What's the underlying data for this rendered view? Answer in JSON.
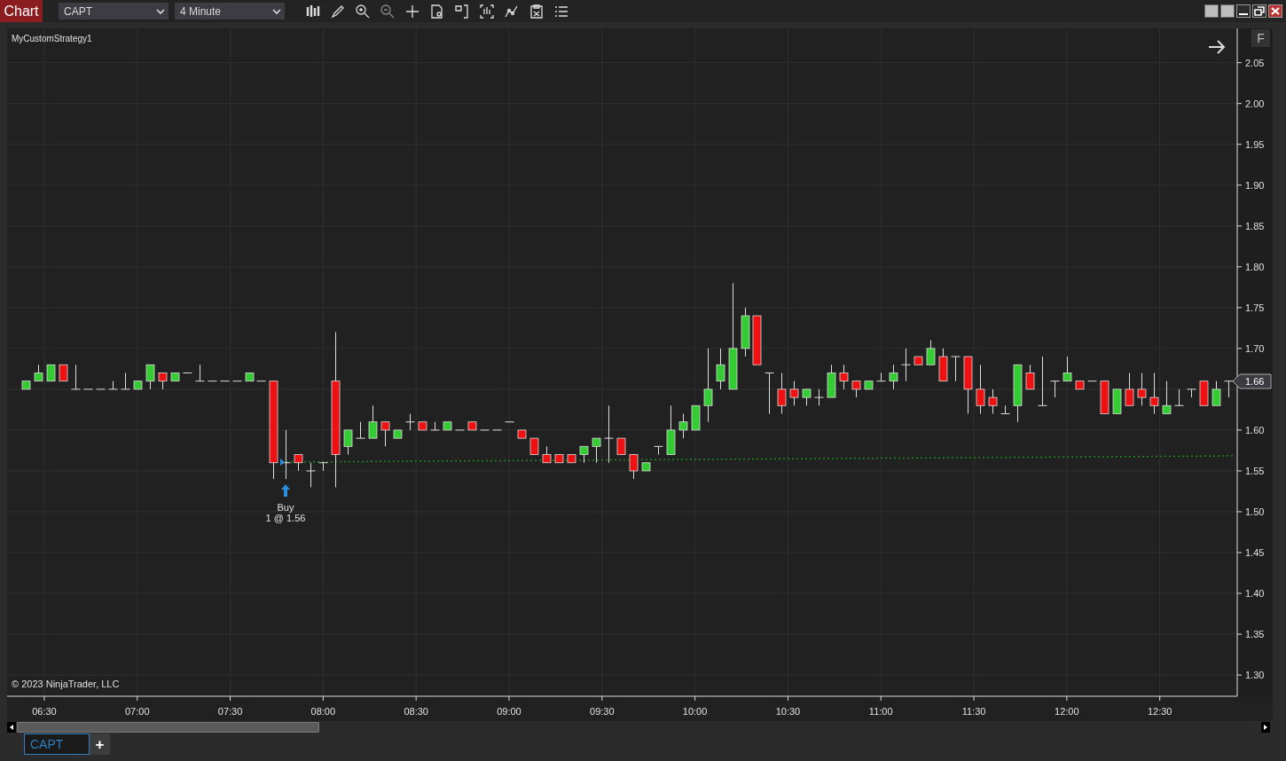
{
  "window": {
    "title": "Chart"
  },
  "toolbar": {
    "instrument": "CAPT",
    "interval": "4 Minute"
  },
  "chart": {
    "strategy_label": "MyCustomStrategy1",
    "scale_button": "F",
    "copyright": "© 2023 NinjaTrader, LLC",
    "current_price": "1.66",
    "execution": {
      "action": "Buy",
      "detail": "1 @ 1.56"
    },
    "chart_data": {
      "type": "candlestick",
      "grid": true,
      "ylim": [
        1.274,
        2.092
      ],
      "xlim": [
        378,
        775
      ],
      "yticks": [
        {
          "value": 2.05,
          "label": "2.05"
        },
        {
          "value": 2.0,
          "label": "2.00"
        },
        {
          "value": 1.95,
          "label": "1.95"
        },
        {
          "value": 1.9,
          "label": "1.90"
        },
        {
          "value": 1.85,
          "label": "1.85"
        },
        {
          "value": 1.8,
          "label": "1.80"
        },
        {
          "value": 1.75,
          "label": "1.75"
        },
        {
          "value": 1.7,
          "label": "1.70"
        },
        {
          "value": 1.6,
          "label": "1.60"
        },
        {
          "value": 1.55,
          "label": "1.55"
        },
        {
          "value": 1.5,
          "label": "1.50"
        },
        {
          "value": 1.45,
          "label": "1.45"
        },
        {
          "value": 1.4,
          "label": "1.40"
        },
        {
          "value": 1.35,
          "label": "1.35"
        },
        {
          "value": 1.3,
          "label": "1.30"
        }
      ],
      "xticks": [
        {
          "value": 390,
          "label": "06:30"
        },
        {
          "value": 420,
          "label": "07:00"
        },
        {
          "value": 450,
          "label": "07:30"
        },
        {
          "value": 480,
          "label": "08:00"
        },
        {
          "value": 510,
          "label": "08:30"
        },
        {
          "value": 540,
          "label": "09:00"
        },
        {
          "value": 570,
          "label": "09:30"
        },
        {
          "value": 600,
          "label": "10:00"
        },
        {
          "value": 630,
          "label": "10:30"
        },
        {
          "value": 660,
          "label": "11:00"
        },
        {
          "value": 690,
          "label": "11:30"
        },
        {
          "value": 720,
          "label": "12:00"
        },
        {
          "value": 750,
          "label": "12:30"
        }
      ],
      "x": [
        384,
        388,
        392,
        396,
        400,
        404,
        408,
        412,
        416,
        420,
        424,
        428,
        432,
        436,
        440,
        444,
        448,
        452,
        456,
        460,
        464,
        468,
        472,
        476,
        480,
        484,
        488,
        492,
        496,
        500,
        504,
        508,
        512,
        516,
        520,
        524,
        528,
        532,
        536,
        540,
        544,
        548,
        552,
        556,
        560,
        564,
        568,
        572,
        576,
        580,
        584,
        588,
        592,
        596,
        600,
        604,
        608,
        612,
        616,
        620,
        624,
        628,
        632,
        636,
        640,
        644,
        648,
        652,
        656,
        660,
        664,
        668,
        672,
        676,
        680,
        684,
        688,
        692,
        696,
        700,
        704,
        708,
        712,
        716,
        720,
        724,
        728,
        732,
        736,
        740,
        744,
        748,
        752,
        756,
        760,
        764,
        768,
        772
      ],
      "ohlc": [
        [
          1.65,
          1.66,
          1.65,
          1.66
        ],
        [
          1.66,
          1.68,
          1.66,
          1.67
        ],
        [
          1.66,
          1.68,
          1.66,
          1.68
        ],
        [
          1.68,
          1.68,
          1.66,
          1.66
        ],
        [
          1.65,
          1.68,
          1.65,
          1.65
        ],
        [
          1.65,
          1.65,
          1.65,
          1.65
        ],
        [
          1.65,
          1.65,
          1.65,
          1.65
        ],
        [
          1.65,
          1.66,
          1.65,
          1.65
        ],
        [
          1.65,
          1.67,
          1.65,
          1.65
        ],
        [
          1.65,
          1.66,
          1.65,
          1.66
        ],
        [
          1.66,
          1.68,
          1.65,
          1.68
        ],
        [
          1.67,
          1.67,
          1.65,
          1.66
        ],
        [
          1.66,
          1.67,
          1.66,
          1.67
        ],
        [
          1.67,
          1.67,
          1.67,
          1.67
        ],
        [
          1.66,
          1.68,
          1.66,
          1.66
        ],
        [
          1.66,
          1.66,
          1.66,
          1.66
        ],
        [
          1.66,
          1.66,
          1.66,
          1.66
        ],
        [
          1.66,
          1.66,
          1.66,
          1.66
        ],
        [
          1.66,
          1.67,
          1.66,
          1.67
        ],
        [
          1.66,
          1.66,
          1.66,
          1.66
        ],
        [
          1.66,
          1.66,
          1.54,
          1.56
        ],
        [
          1.56,
          1.6,
          1.54,
          1.56
        ],
        [
          1.57,
          1.57,
          1.55,
          1.56
        ],
        [
          1.55,
          1.56,
          1.53,
          1.55
        ],
        [
          1.56,
          1.56,
          1.55,
          1.56
        ],
        [
          1.66,
          1.72,
          1.53,
          1.57
        ],
        [
          1.58,
          1.6,
          1.57,
          1.6
        ],
        [
          1.59,
          1.61,
          1.59,
          1.59
        ],
        [
          1.59,
          1.63,
          1.59,
          1.61
        ],
        [
          1.61,
          1.61,
          1.58,
          1.6
        ],
        [
          1.59,
          1.6,
          1.59,
          1.6
        ],
        [
          1.61,
          1.62,
          1.6,
          1.61
        ],
        [
          1.61,
          1.61,
          1.6,
          1.6
        ],
        [
          1.6,
          1.61,
          1.6,
          1.6
        ],
        [
          1.6,
          1.61,
          1.6,
          1.61
        ],
        [
          1.6,
          1.6,
          1.6,
          1.6
        ],
        [
          1.61,
          1.61,
          1.6,
          1.6
        ],
        [
          1.6,
          1.6,
          1.6,
          1.6
        ],
        [
          1.6,
          1.6,
          1.6,
          1.6
        ],
        [
          1.61,
          1.61,
          1.61,
          1.61
        ],
        [
          1.6,
          1.6,
          1.59,
          1.59
        ],
        [
          1.59,
          1.59,
          1.57,
          1.57
        ],
        [
          1.57,
          1.58,
          1.56,
          1.56
        ],
        [
          1.57,
          1.57,
          1.56,
          1.56
        ],
        [
          1.57,
          1.57,
          1.56,
          1.56
        ],
        [
          1.57,
          1.58,
          1.56,
          1.58
        ],
        [
          1.58,
          1.59,
          1.56,
          1.59
        ],
        [
          1.59,
          1.63,
          1.56,
          1.59
        ],
        [
          1.59,
          1.59,
          1.57,
          1.57
        ],
        [
          1.57,
          1.57,
          1.54,
          1.55
        ],
        [
          1.55,
          1.56,
          1.55,
          1.56
        ],
        [
          1.58,
          1.58,
          1.57,
          1.58
        ],
        [
          1.57,
          1.63,
          1.57,
          1.6
        ],
        [
          1.6,
          1.62,
          1.59,
          1.61
        ],
        [
          1.6,
          1.63,
          1.6,
          1.63
        ],
        [
          1.63,
          1.7,
          1.61,
          1.65
        ],
        [
          1.66,
          1.7,
          1.65,
          1.68
        ],
        [
          1.65,
          1.78,
          1.65,
          1.7
        ],
        [
          1.7,
          1.75,
          1.69,
          1.74
        ],
        [
          1.74,
          1.74,
          1.68,
          1.68
        ],
        [
          1.67,
          1.67,
          1.62,
          1.67
        ],
        [
          1.65,
          1.67,
          1.62,
          1.63
        ],
        [
          1.65,
          1.66,
          1.63,
          1.64
        ],
        [
          1.64,
          1.65,
          1.63,
          1.65
        ],
        [
          1.64,
          1.65,
          1.63,
          1.64
        ],
        [
          1.64,
          1.68,
          1.64,
          1.67
        ],
        [
          1.67,
          1.68,
          1.65,
          1.66
        ],
        [
          1.66,
          1.66,
          1.64,
          1.65
        ],
        [
          1.65,
          1.66,
          1.65,
          1.66
        ],
        [
          1.66,
          1.67,
          1.66,
          1.66
        ],
        [
          1.66,
          1.68,
          1.65,
          1.67
        ],
        [
          1.68,
          1.7,
          1.66,
          1.68
        ],
        [
          1.69,
          1.69,
          1.68,
          1.68
        ],
        [
          1.68,
          1.71,
          1.68,
          1.7
        ],
        [
          1.69,
          1.7,
          1.66,
          1.66
        ],
        [
          1.69,
          1.69,
          1.66,
          1.69
        ],
        [
          1.69,
          1.69,
          1.62,
          1.65
        ],
        [
          1.65,
          1.68,
          1.62,
          1.63
        ],
        [
          1.64,
          1.65,
          1.62,
          1.63
        ],
        [
          1.62,
          1.63,
          1.62,
          1.62
        ],
        [
          1.63,
          1.68,
          1.61,
          1.68
        ],
        [
          1.67,
          1.68,
          1.65,
          1.65
        ],
        [
          1.63,
          1.69,
          1.63,
          1.63
        ],
        [
          1.66,
          1.66,
          1.64,
          1.66
        ],
        [
          1.66,
          1.69,
          1.66,
          1.67
        ],
        [
          1.66,
          1.66,
          1.65,
          1.65
        ],
        [
          1.66,
          1.66,
          1.66,
          1.66
        ],
        [
          1.66,
          1.66,
          1.62,
          1.62
        ],
        [
          1.62,
          1.65,
          1.62,
          1.65
        ],
        [
          1.65,
          1.67,
          1.63,
          1.63
        ],
        [
          1.65,
          1.67,
          1.63,
          1.64
        ],
        [
          1.64,
          1.67,
          1.62,
          1.63
        ],
        [
          1.62,
          1.66,
          1.62,
          1.63
        ],
        [
          1.63,
          1.65,
          1.63,
          1.63
        ],
        [
          1.65,
          1.65,
          1.64,
          1.65
        ],
        [
          1.66,
          1.66,
          1.63,
          1.63
        ],
        [
          1.63,
          1.66,
          1.63,
          1.65
        ],
        [
          1.66,
          1.66,
          1.64,
          1.66
        ]
      ]
    }
  },
  "tabs": [
    {
      "label": "CAPT",
      "selected": true
    }
  ],
  "add_tab": "+"
}
